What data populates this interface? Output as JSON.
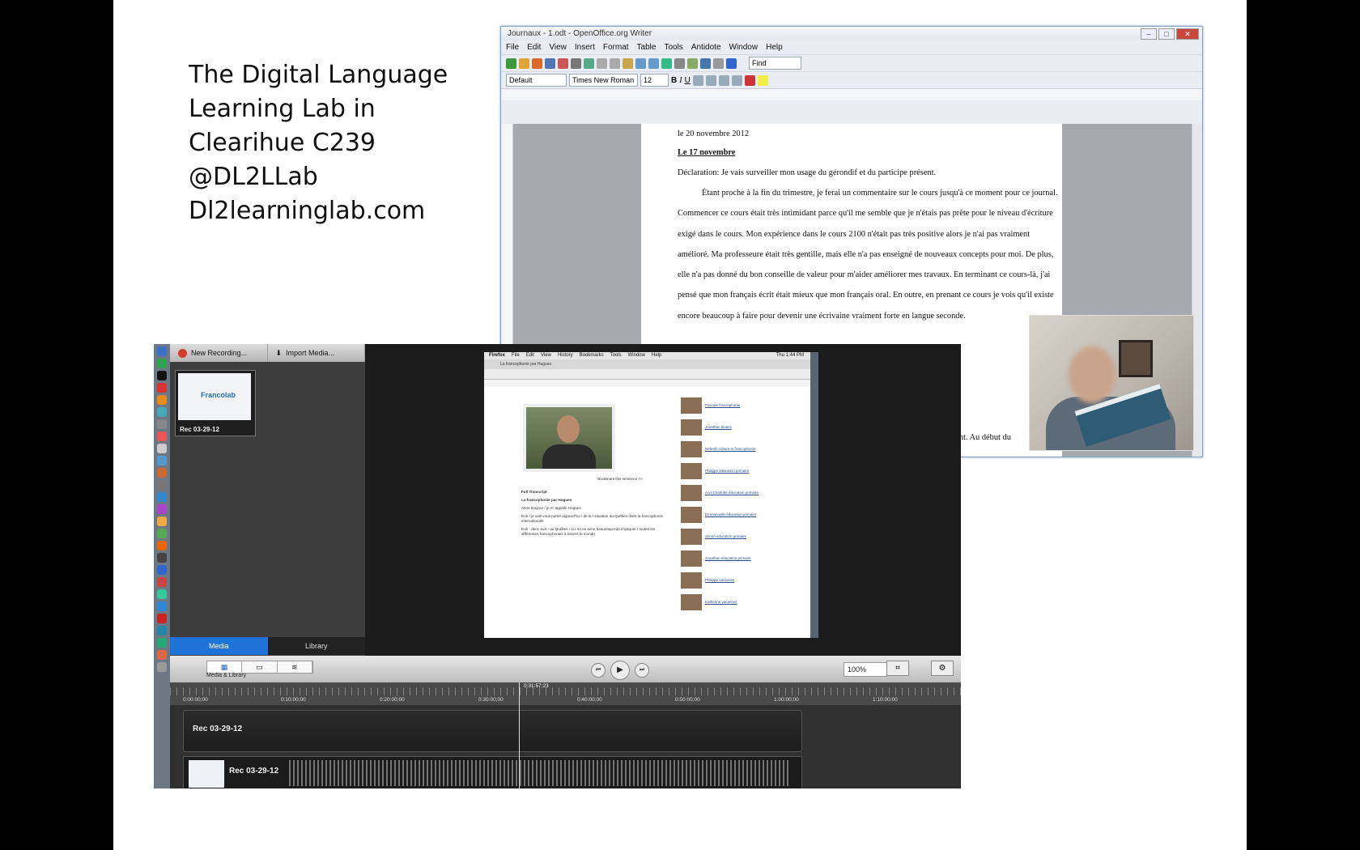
{
  "slide_text": [
    "The Digital Language",
    "Learning Lab in",
    "Clearihue C239",
    "@DL2LLab",
    "Dl2learninglab.com"
  ],
  "writer": {
    "title": "Journaux - 1.odt - OpenOffice.org Writer",
    "menu": [
      "File",
      "Edit",
      "View",
      "Insert",
      "Format",
      "Table",
      "Tools",
      "Antidote",
      "Window",
      "Help"
    ],
    "find_placeholder": "Find",
    "style_value": "Default",
    "font_value": "Times New Roman",
    "size_value": "12",
    "doc": {
      "date": "le 20 novembre 2012",
      "heading": "Le 17 novembre",
      "declaration": "Déclaration: Je vais surveiller mon usage du gérondif et du participe présent.",
      "paragraph1": "Étant proche à la fin du trimestre, je ferai un commentaire sur le cours jusqu'à ce moment pour ce journal. Commencer ce cours était très intimidant parce qu'il me semble que je n'étais pas prête pour le niveau d'écriture exigé dans le cours. Mon expérience dans le cours 2100 n'était pas très positive alors je n'ai pas vraiment amélioré. Ma professeure était très gentille, mais elle n'a pas enseigné de nouveaux concepts pour moi. De plus, elle n'a pas donné du bon conseille de valeur pour m'aider améliorer mes travaux. En terminant ce cours-là, j'ai pensé que mon français écrit était mieux que mon français oral. En outre, en prenant ce cours je vois qu'il existe encore beaucoup à faire pour devenir une écrivaine vraiment forte en langue seconde.",
      "paragraph2": "Cependant, je suis fière du mon progrès dans le cours 3702 jusqu'à maintenant. Au début du"
    }
  },
  "camtasia": {
    "new_recording": "New Recording...",
    "import_media": "Import Media...",
    "thumb_label": "Rec 03-29-12",
    "tabs": [
      "Media",
      "Library"
    ],
    "view_label": "Media & Library",
    "zoom": "100%",
    "playhead_time": "0:31:57;23",
    "ruler_ticks": [
      "0:00:00;00",
      "0:10:00;00",
      "0:20:00;00",
      "0:30:00;00",
      "0:40:00;00",
      "0:50:00;00",
      "1:00:00;00",
      "1:10:00;00"
    ],
    "track1_label": "Rec 03-29-12",
    "track2_label": "Rec 03-29-12"
  },
  "browser": {
    "menu": [
      "Firefox",
      "File",
      "Edit",
      "View",
      "History",
      "Bookmarks",
      "Tools",
      "Window",
      "Help"
    ],
    "tab_title": "La francophonie par Hugues",
    "clock": "Thu 1:44 PM",
    "full_transcript": "Full Transcript",
    "transcript_title": "La francophonie par Hugues",
    "transcript_lines": [
      "Alors bonjour / je m' appelle Hugues",
      "Euh / je vais vous parler aujourd'hui / de la / situation du Québec dans la francophonie internationale",
      "Euh - donc euh - au Québec / si / on on aime beaucoup euh impliquer / toutes les différentes francophonies à travers le monde"
    ],
    "people": [
      "Pascale francophonie",
      "Jonathan bisans",
      "Nefertiti culture et francophonie",
      "Philippe éducation primaire",
      "Ann-Charlotte éducation primaire",
      "Emmanuelle éducation primaire",
      "Simon éducation primaire",
      "Jonathan éducation primaire",
      "Philippe vacances",
      "Katherine vacances"
    ],
    "bookmark": "Bookmark this sentence >>"
  },
  "colors": {
    "accent_blue": "#1f73d8",
    "record_red": "#d53a2e"
  }
}
